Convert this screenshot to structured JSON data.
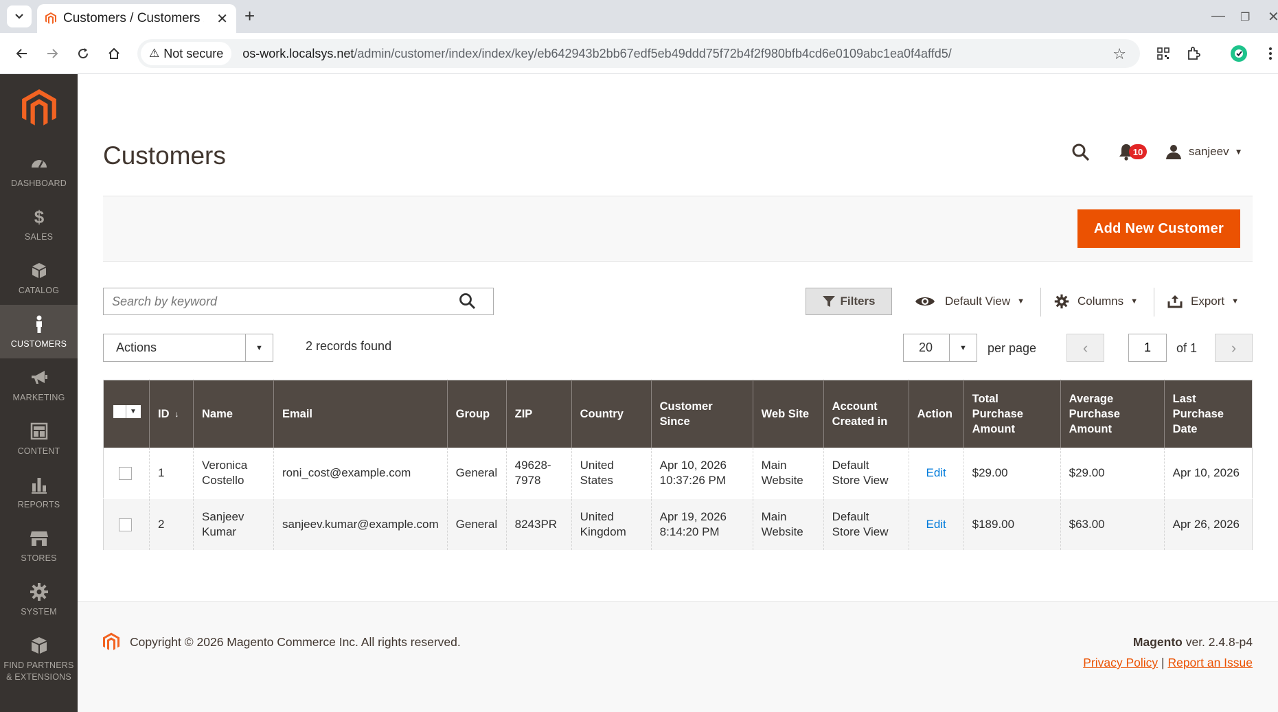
{
  "browser": {
    "tab_title": "Customers / Customers /",
    "secure_label": "Not secure",
    "url_host": "os-work.localsys.net",
    "url_path": "/admin/customer/index/index/key/eb642943b2bb67edf5eb49ddd75f72b4f2f980bfb4cd6e0109abc1ea0f4affd5/"
  },
  "sidebar": {
    "items": [
      {
        "label": "DASHBOARD",
        "icon": "dashboard-icon"
      },
      {
        "label": "SALES",
        "icon": "dollar-icon"
      },
      {
        "label": "CATALOG",
        "icon": "box-icon"
      },
      {
        "label": "CUSTOMERS",
        "icon": "person-icon"
      },
      {
        "label": "MARKETING",
        "icon": "megaphone-icon"
      },
      {
        "label": "CONTENT",
        "icon": "layout-icon"
      },
      {
        "label": "REPORTS",
        "icon": "bar-chart-icon"
      },
      {
        "label": "STORES",
        "icon": "store-icon"
      },
      {
        "label": "SYSTEM",
        "icon": "gear-icon"
      },
      {
        "label": "FIND PARTNERS",
        "label2": "& EXTENSIONS",
        "icon": "cubes-icon"
      }
    ]
  },
  "header": {
    "title": "Customers",
    "notifications": "10",
    "user": "sanjeev"
  },
  "actionbar": {
    "add_button": "Add New Customer"
  },
  "toolbar": {
    "search_placeholder": "Search by keyword",
    "filters": "Filters",
    "default_view": "Default View",
    "columns": "Columns",
    "export": "Export",
    "actions": "Actions",
    "records_found": "2 records found",
    "per_page_value": "20",
    "per_page_label": "per page",
    "page": "1",
    "page_of": "of 1"
  },
  "grid": {
    "headers": {
      "id": "ID",
      "name": "Name",
      "email": "Email",
      "group": "Group",
      "zip": "ZIP",
      "country": "Country",
      "customer_since": "Customer Since",
      "website": "Web Site",
      "created_in_1": "Account",
      "created_in_2": "Created in",
      "action": "Action",
      "total_1": "Total Purchase",
      "total_2": "Amount",
      "avg_1": "Average",
      "avg_2": "Purchase",
      "avg_3": "Amount",
      "last_1": "Last",
      "last_2": "Purchase",
      "last_3": "Date"
    },
    "rows": [
      {
        "id": "1",
        "name_1": "Veronica",
        "name_2": "Costello",
        "email": "roni_cost@example.com",
        "group": "General",
        "zip_1": "49628-",
        "zip_2": "7978",
        "country_1": "United",
        "country_2": "States",
        "since_1": "Apr 10, 2026",
        "since_2": "10:37:26 PM",
        "website_1": "Main",
        "website_2": "Website",
        "created_1": "Default",
        "created_2": "Store View",
        "action": "Edit",
        "total": "$29.00",
        "avg": "$29.00",
        "last": "Apr 10, 2026"
      },
      {
        "id": "2",
        "name_1": "Sanjeev",
        "name_2": "Kumar",
        "email": "sanjeev.kumar@example.com",
        "group": "General",
        "zip_1": "8243PR",
        "zip_2": "",
        "country_1": "United",
        "country_2": "Kingdom",
        "since_1": "Apr 19, 2026",
        "since_2": "8:14:20 PM",
        "website_1": "Main",
        "website_2": "Website",
        "created_1": "Default",
        "created_2": "Store View",
        "action": "Edit",
        "total": "$189.00",
        "avg": "$63.00",
        "last": "Apr 26, 2026"
      }
    ]
  },
  "footer": {
    "copyright": "Copyright © 2026 Magento Commerce Inc. All rights reserved.",
    "brand": "Magento",
    "version": " ver. 2.4.8-p4",
    "privacy": "Privacy Policy",
    "separator": "|",
    "report": "Report an Issue"
  },
  "colors": {
    "accent": "#eb5202",
    "sidebar": "#373330",
    "grid_header": "#514943",
    "link": "#007bdb"
  }
}
